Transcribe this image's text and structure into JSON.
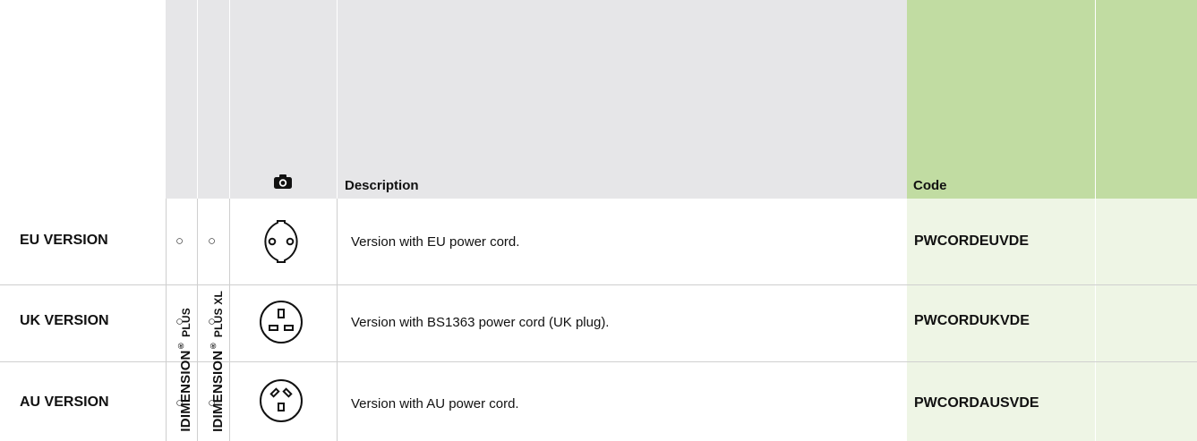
{
  "header": {
    "col_plus": {
      "main": "IDIMENSION",
      "reg": "®",
      "suffix": "PLUS"
    },
    "col_plus_xl": {
      "main": "IDIMENSION",
      "reg": "®",
      "suffix": "PLUS XL"
    },
    "photo_icon": "camera-icon",
    "description": "Description",
    "code": "Code"
  },
  "rows": [
    {
      "label": "EU VERSION",
      "plus": "○",
      "plus_xl": "○",
      "plug_icon": "eu-plug-icon",
      "description": "Version with EU power cord.",
      "code": "PWCORDEUVDE"
    },
    {
      "label": "UK VERSION",
      "plus": "○",
      "plus_xl": "○",
      "plug_icon": "uk-plug-icon",
      "description": "Version with BS1363 power cord (UK plug).",
      "code": "PWCORDUKVDE"
    },
    {
      "label": "AU VERSION",
      "plus": "○",
      "plus_xl": "○",
      "plug_icon": "au-plug-icon",
      "description": "Version with AU power cord.",
      "code": "PWCORDAUSVDE"
    }
  ],
  "colors": {
    "header_grey": "#e6e6e8",
    "header_green": "#c1dca2",
    "body_green": "#eef5e5"
  }
}
